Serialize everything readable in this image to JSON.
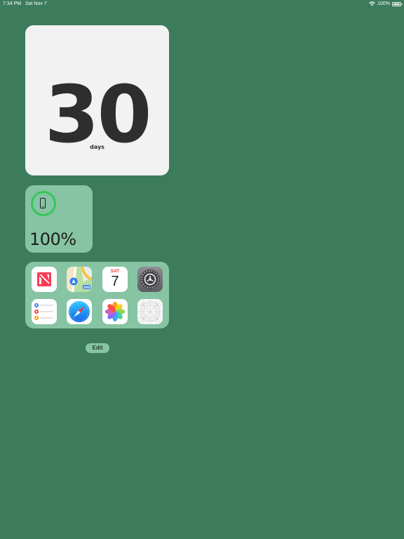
{
  "status_bar": {
    "time": "7:34 PM",
    "date": "Sat Nov 7",
    "battery_pct": "100%"
  },
  "days_widget": {
    "number": "30",
    "label": "days"
  },
  "battery_widget": {
    "percent": "100%",
    "level": 1.0
  },
  "apps": [
    {
      "name": "News",
      "icon": "news-icon"
    },
    {
      "name": "Maps",
      "icon": "maps-icon"
    },
    {
      "name": "Calendar",
      "icon": "calendar-icon",
      "day": "SAT",
      "date": "7"
    },
    {
      "name": "Settings",
      "icon": "settings-icon"
    },
    {
      "name": "Reminders",
      "icon": "reminders-icon"
    },
    {
      "name": "Safari",
      "icon": "safari-icon"
    },
    {
      "name": "Photos",
      "icon": "photos-icon"
    },
    {
      "name": "Placeholder",
      "icon": "app-grid-icon"
    }
  ],
  "edit_button": {
    "label": "Edit"
  },
  "colors": {
    "background": "#3c7c5c",
    "widget_green": "#86c4a3",
    "ring_green": "#34c759"
  }
}
